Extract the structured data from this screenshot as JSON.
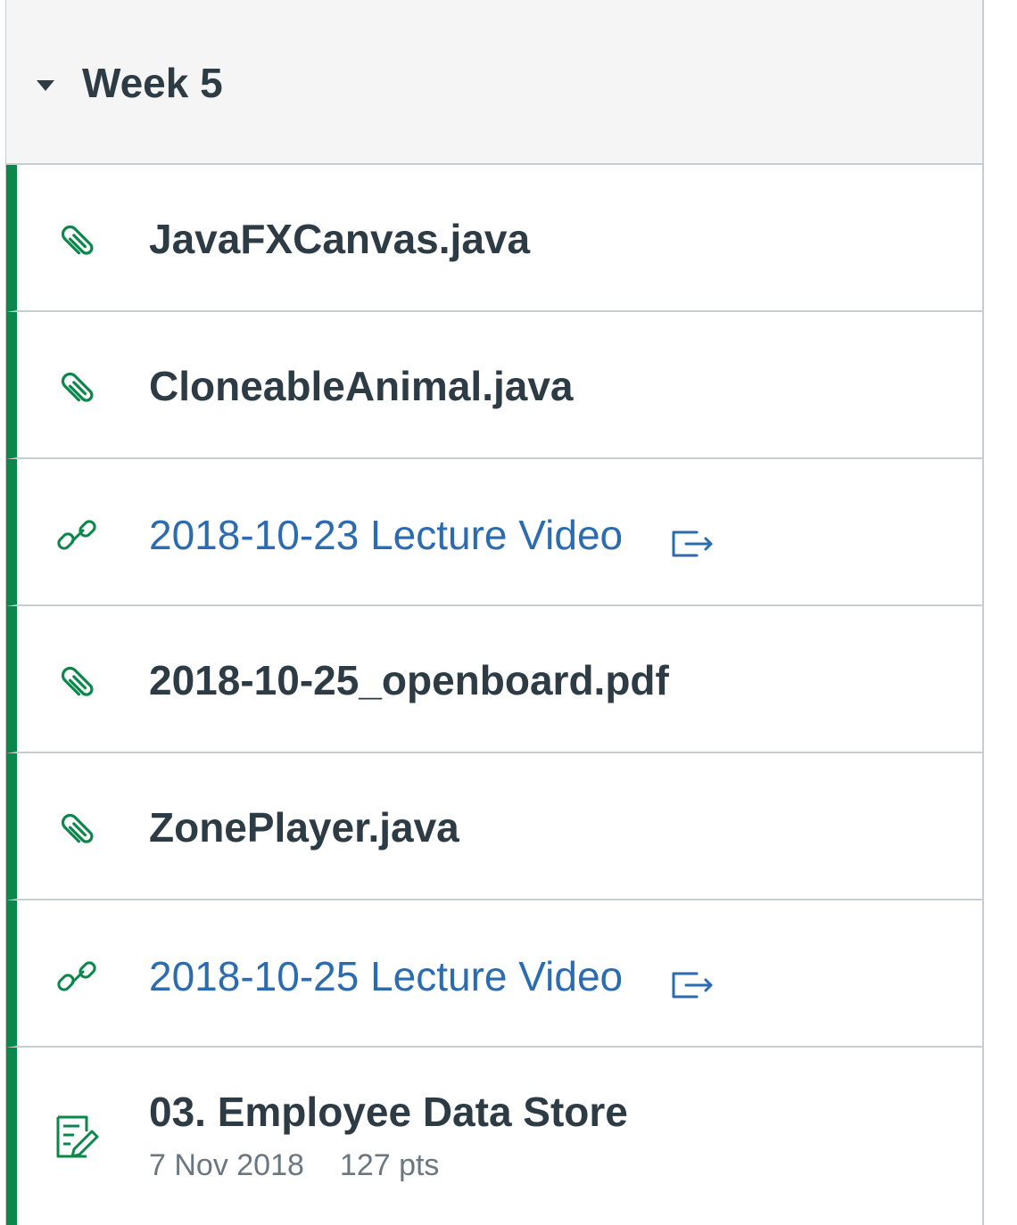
{
  "module": {
    "title": "Week 5"
  },
  "items": [
    {
      "title": "JavaFXCanvas.java",
      "icon": "paperclip-icon",
      "type": "file"
    },
    {
      "title": "CloneableAnimal.java",
      "icon": "paperclip-icon",
      "type": "file"
    },
    {
      "title": "2018-10-23 Lecture Video",
      "icon": "link-icon",
      "type": "external-link"
    },
    {
      "title": "2018-10-25_openboard.pdf",
      "icon": "paperclip-icon",
      "type": "file"
    },
    {
      "title": "ZonePlayer.java",
      "icon": "paperclip-icon",
      "type": "file"
    },
    {
      "title": "2018-10-25 Lecture Video",
      "icon": "link-icon",
      "type": "external-link"
    },
    {
      "title": "03. Employee Data Store",
      "icon": "assignment-icon",
      "type": "assignment",
      "due": "7 Nov 2018",
      "points": "127 pts"
    }
  ],
  "colors": {
    "published_bar": "#0b874b",
    "link_text": "#2b6cb0",
    "text": "#2d3b45",
    "header_bg": "#f5f5f5",
    "border": "#c7cdd1"
  }
}
